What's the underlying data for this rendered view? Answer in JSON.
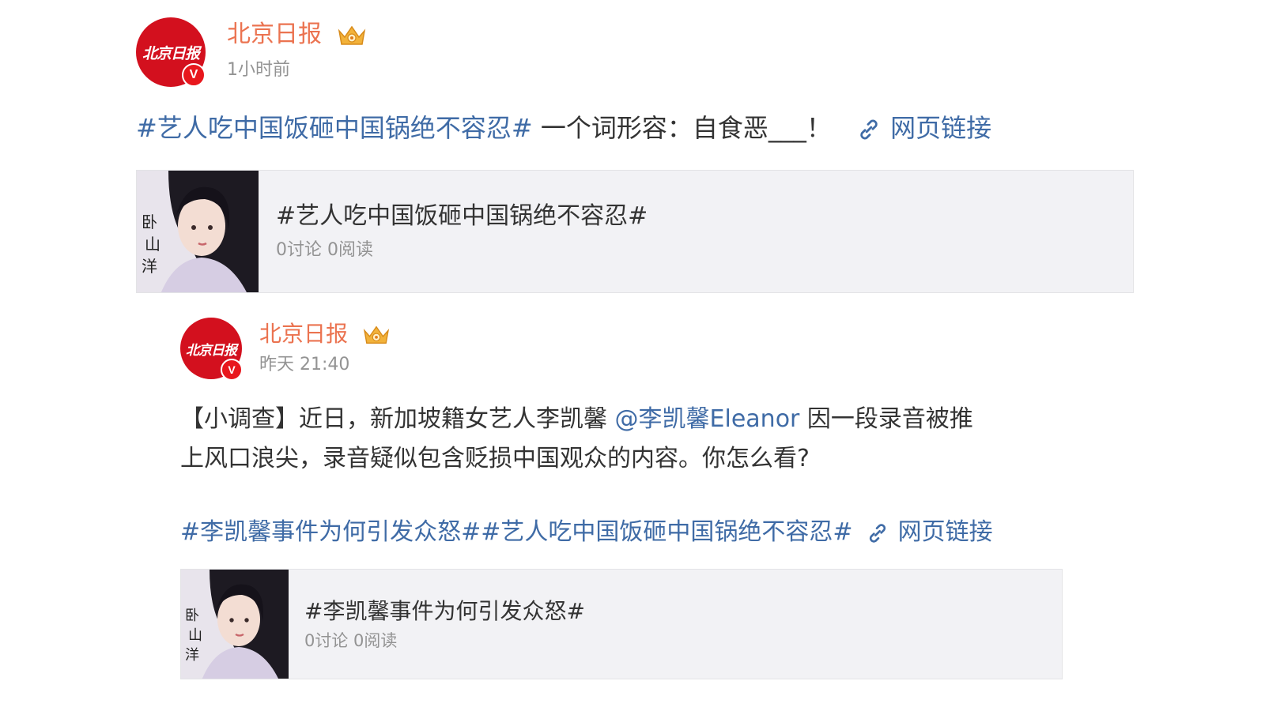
{
  "post": {
    "author": "北京日报",
    "avatar_text": "北京日报",
    "verified_mark": "V",
    "time": "1小时前",
    "topic_tag": "#艺人吃中国饭砸中国锅绝不容忍#",
    "text": "一个词形容：自食恶___！",
    "link_label": "网页链接",
    "card": {
      "title": "#艺人吃中国饭砸中国锅绝不容忍#",
      "meta": "0讨论 0阅读"
    }
  },
  "repost": {
    "author": "北京日报",
    "avatar_text": "北京日报",
    "verified_mark": "V",
    "time": "昨天 21:40",
    "text_part1": "【小调查】近日，新加坡籍女艺人李凯馨 ",
    "mention": "@李凯馨Eleanor",
    "text_part2": " 因一段录音被推",
    "text_line2": "上风口浪尖，录音疑似包含贬损中国观众的内容。你怎么看?",
    "topic_tags": "#李凯馨事件为何引发众怒##艺人吃中国饭砸中国锅绝不容忍#",
    "link_label": "网页链接",
    "card": {
      "title": "#李凯馨事件为何引发众怒#",
      "meta": "0讨论 0阅读"
    }
  },
  "colors": {
    "username": "#eb7350",
    "topic": "#3f6ba6",
    "avatar_bg": "#d3101e",
    "card_bg": "#f2f2f5"
  }
}
